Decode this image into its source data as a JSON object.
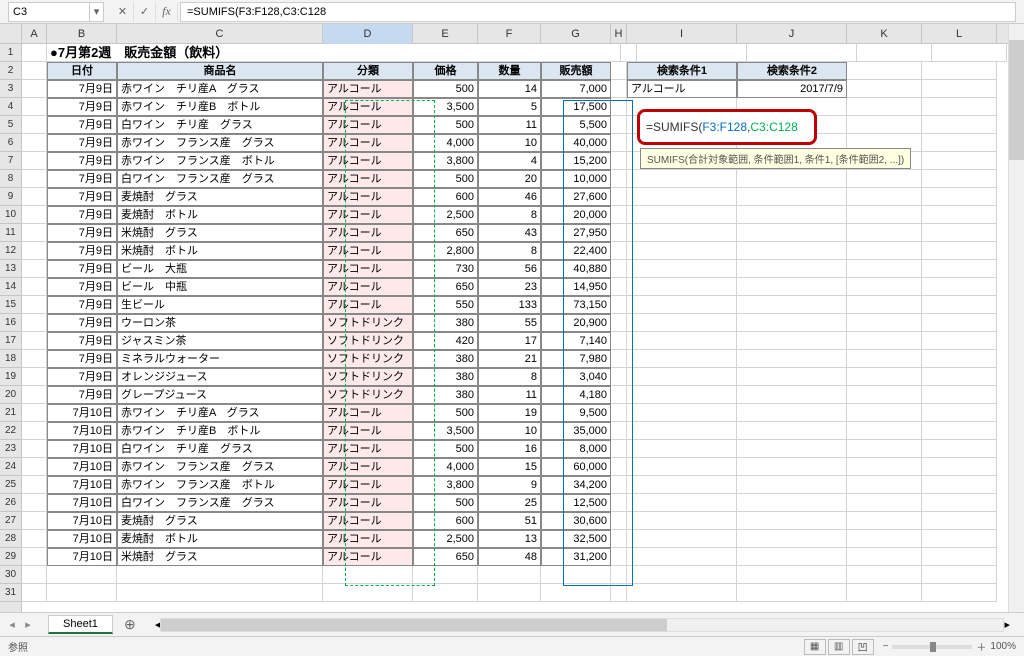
{
  "formula_bar": {
    "name_box": "C3",
    "formula": "=SUMIFS(F3:F128,C3:C128"
  },
  "columns": [
    "A",
    "B",
    "C",
    "D",
    "E",
    "F",
    "G",
    "H",
    "I",
    "J",
    "K"
  ],
  "title": "●7月第2週　販売金額（飲料）",
  "headers": {
    "date": "日付",
    "product": "商品名",
    "category": "分類",
    "price": "価格",
    "qty": "数量",
    "sales": "販売額",
    "cond1": "検索条件1",
    "cond2": "検索条件2"
  },
  "cond_values": {
    "cond1": "アルコール",
    "cond2": "2017/7/9"
  },
  "formula_cell": {
    "prefix": "=SUMIFS(",
    "arg1": "F3:F128",
    "comma": ",",
    "arg2": "C3:C128"
  },
  "tooltip": "SUMIFS(合計対象範囲, 条件範囲1, 条件1, [条件範囲2, ...])",
  "rows": [
    {
      "r": 3,
      "date": "7月9日",
      "product": "赤ワイン　チリ産A　グラス",
      "cat": "アルコール",
      "price": "500",
      "qty": "14",
      "sales": "7,000"
    },
    {
      "r": 4,
      "date": "7月9日",
      "product": "赤ワイン　チリ産B　ボトル",
      "cat": "アルコール",
      "price": "3,500",
      "qty": "5",
      "sales": "17,500"
    },
    {
      "r": 5,
      "date": "7月9日",
      "product": "白ワイン　チリ産　グラス",
      "cat": "アルコール",
      "price": "500",
      "qty": "11",
      "sales": "5,500"
    },
    {
      "r": 6,
      "date": "7月9日",
      "product": "赤ワイン　フランス産　グラス",
      "cat": "アルコール",
      "price": "4,000",
      "qty": "10",
      "sales": "40,000"
    },
    {
      "r": 7,
      "date": "7月9日",
      "product": "赤ワイン　フランス産　ボトル",
      "cat": "アルコール",
      "price": "3,800",
      "qty": "4",
      "sales": "15,200"
    },
    {
      "r": 8,
      "date": "7月9日",
      "product": "白ワイン　フランス産　グラス",
      "cat": "アルコール",
      "price": "500",
      "qty": "20",
      "sales": "10,000"
    },
    {
      "r": 9,
      "date": "7月9日",
      "product": "麦焼酎　グラス",
      "cat": "アルコール",
      "price": "600",
      "qty": "46",
      "sales": "27,600"
    },
    {
      "r": 10,
      "date": "7月9日",
      "product": "麦焼酎　ボトル",
      "cat": "アルコール",
      "price": "2,500",
      "qty": "8",
      "sales": "20,000"
    },
    {
      "r": 11,
      "date": "7月9日",
      "product": "米焼酎　グラス",
      "cat": "アルコール",
      "price": "650",
      "qty": "43",
      "sales": "27,950"
    },
    {
      "r": 12,
      "date": "7月9日",
      "product": "米焼酎　ボトル",
      "cat": "アルコール",
      "price": "2,800",
      "qty": "8",
      "sales": "22,400"
    },
    {
      "r": 13,
      "date": "7月9日",
      "product": "ビール　大瓶",
      "cat": "アルコール",
      "price": "730",
      "qty": "56",
      "sales": "40,880"
    },
    {
      "r": 14,
      "date": "7月9日",
      "product": "ビール　中瓶",
      "cat": "アルコール",
      "price": "650",
      "qty": "23",
      "sales": "14,950"
    },
    {
      "r": 15,
      "date": "7月9日",
      "product": "生ビール",
      "cat": "アルコール",
      "price": "550",
      "qty": "133",
      "sales": "73,150"
    },
    {
      "r": 16,
      "date": "7月9日",
      "product": "ウーロン茶",
      "cat": "ソフトドリンク",
      "price": "380",
      "qty": "55",
      "sales": "20,900"
    },
    {
      "r": 17,
      "date": "7月9日",
      "product": "ジャスミン茶",
      "cat": "ソフトドリンク",
      "price": "420",
      "qty": "17",
      "sales": "7,140"
    },
    {
      "r": 18,
      "date": "7月9日",
      "product": "ミネラルウォーター",
      "cat": "ソフトドリンク",
      "price": "380",
      "qty": "21",
      "sales": "7,980"
    },
    {
      "r": 19,
      "date": "7月9日",
      "product": "オレンジジュース",
      "cat": "ソフトドリンク",
      "price": "380",
      "qty": "8",
      "sales": "3,040"
    },
    {
      "r": 20,
      "date": "7月9日",
      "product": "グレープジュース",
      "cat": "ソフトドリンク",
      "price": "380",
      "qty": "11",
      "sales": "4,180"
    },
    {
      "r": 21,
      "date": "7月10日",
      "product": "赤ワイン　チリ産A　グラス",
      "cat": "アルコール",
      "price": "500",
      "qty": "19",
      "sales": "9,500"
    },
    {
      "r": 22,
      "date": "7月10日",
      "product": "赤ワイン　チリ産B　ボトル",
      "cat": "アルコール",
      "price": "3,500",
      "qty": "10",
      "sales": "35,000"
    },
    {
      "r": 23,
      "date": "7月10日",
      "product": "白ワイン　チリ産　グラス",
      "cat": "アルコール",
      "price": "500",
      "qty": "16",
      "sales": "8,000"
    },
    {
      "r": 24,
      "date": "7月10日",
      "product": "赤ワイン　フランス産　グラス",
      "cat": "アルコール",
      "price": "4,000",
      "qty": "15",
      "sales": "60,000"
    },
    {
      "r": 25,
      "date": "7月10日",
      "product": "赤ワイン　フランス産　ボトル",
      "cat": "アルコール",
      "price": "3,800",
      "qty": "9",
      "sales": "34,200"
    },
    {
      "r": 26,
      "date": "7月10日",
      "product": "白ワイン　フランス産　グラス",
      "cat": "アルコール",
      "price": "500",
      "qty": "25",
      "sales": "12,500"
    },
    {
      "r": 27,
      "date": "7月10日",
      "product": "麦焼酎　グラス",
      "cat": "アルコール",
      "price": "600",
      "qty": "51",
      "sales": "30,600"
    },
    {
      "r": 28,
      "date": "7月10日",
      "product": "麦焼酎　ボトル",
      "cat": "アルコール",
      "price": "2,500",
      "qty": "13",
      "sales": "32,500"
    },
    {
      "r": 29,
      "date": "7月10日",
      "product": "米焼酎　グラス",
      "cat": "アルコール",
      "price": "650",
      "qty": "48",
      "sales": "31,200"
    }
  ],
  "sheet_tab": "Sheet1",
  "status": {
    "mode": "参照",
    "zoom": "100%"
  }
}
